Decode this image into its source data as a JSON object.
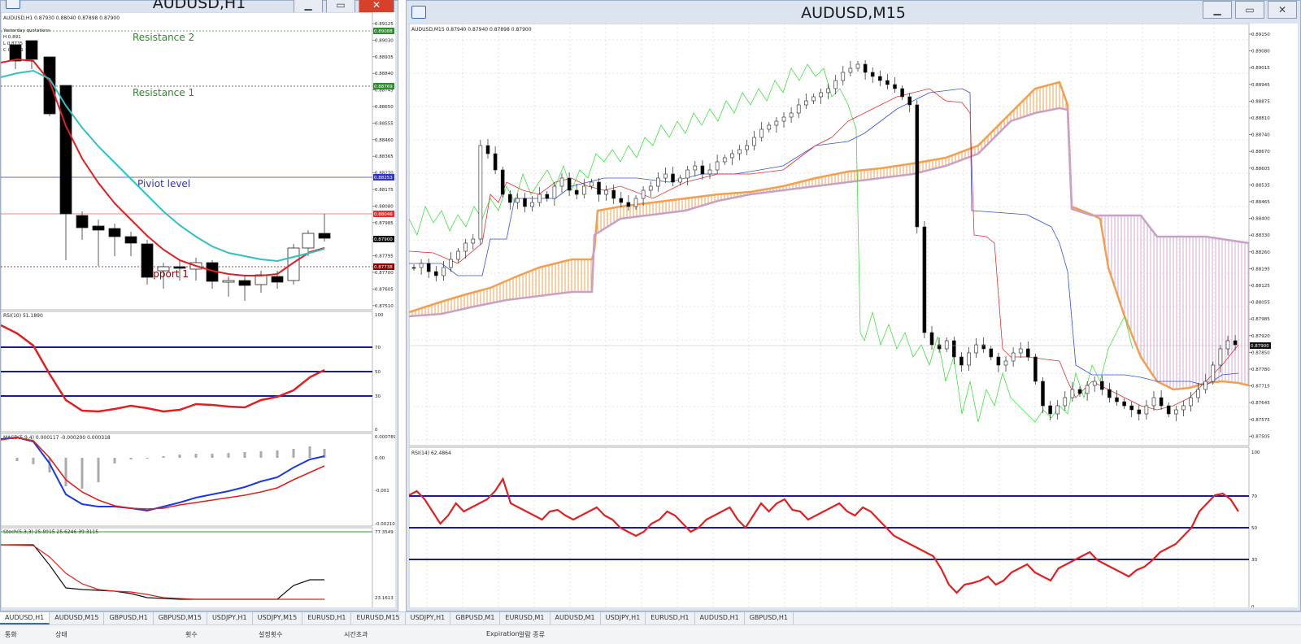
{
  "left_window": {
    "title": "AUDUSD,H1",
    "info_line": "AUDUSD,H1  0.87930 0.88040 0.87898 0.87900",
    "yesterday_label": "Yesterday quotations",
    "yesterday_h": "H 0.891",
    "yesterday_l": "L 0.8735",
    "yesterday_c": "C 0.8791",
    "annotations": {
      "resistance2": "Resistance 2",
      "resistance1": "Resistance 1",
      "pivot": "Piviot level",
      "support1": "Support 1"
    },
    "price_axis": [
      "0.89125",
      "0.89030",
      "0.88935",
      "0.88840",
      "0.88745",
      "0.88650",
      "0.88555",
      "0.88460",
      "0.88365",
      "0.88270",
      "0.88175",
      "0.88080",
      "0.87985",
      "0.87890",
      "0.87795",
      "0.87700",
      "0.87605",
      "0.87510"
    ],
    "price_tags": {
      "r2": "0.89088",
      "r1": "0.88769",
      "pivot": "0.88253",
      "red": "0.88046",
      "current": "0.87900",
      "s1": "0.87738"
    },
    "rsi_label": "RSI(10) 51.1890",
    "rsi_axis": [
      "100",
      "70",
      "50",
      "30",
      "0"
    ],
    "macd_label": "MACD(5,9,4) 0.000117 -0.000200 0.000318",
    "macd_axis": [
      "0.000789",
      "0.00",
      "-0.001",
      "-0.002107"
    ],
    "stoch_label": "Stoch(5,3,3) 25.8915 25.6246 39.3115",
    "stoch_axis": [
      "77.3549",
      "23.1613"
    ],
    "colors": {
      "annotation_green": "#2e8b2e",
      "pivot_blue": "#3030d0",
      "support_red": "#8b0000"
    }
  },
  "right_window": {
    "title": "AUDUSD,M15",
    "info_line": "AUDUSD,M15  0.87940 0.87940 0.87898 0.87900",
    "price_axis": [
      "0.89150",
      "0.89080",
      "0.89015",
      "0.88945",
      "0.88875",
      "0.88810",
      "0.88740",
      "0.88670",
      "0.88605",
      "0.88535",
      "0.88465",
      "0.88400",
      "0.88330",
      "0.88260",
      "0.88195",
      "0.88125",
      "0.88055",
      "0.87985",
      "0.87920",
      "0.87850",
      "0.87780",
      "0.87715",
      "0.87645",
      "0.87575",
      "0.87505"
    ],
    "current_price": "0.87900",
    "rsi_label": "RSI(14) 62.4864",
    "rsi_axis": [
      "100",
      "70",
      "50",
      "30",
      "0"
    ],
    "colors": {
      "kumo_bull": "#f0a050",
      "kumo_bear": "#c8a0c8",
      "tenkan": "#e03030",
      "kijun": "#3050e0",
      "chikou": "#40e040"
    }
  },
  "tabs": [
    "AUDUSD,H1",
    "AUDUSD,M15",
    "GBPUSD,H1",
    "GBPUSD,M15",
    "USDJPY,H1",
    "USDJPY,M15",
    "EURUSD,H1",
    "EURUSD,M15",
    "USDJPY,H1",
    "GBPUSD,M1",
    "EURUSD,M1",
    "AUDUSD,M1",
    "USDJPY,H1",
    "EURUSD,H1",
    "AUDUSD,H1",
    "GBPUSD,H1"
  ],
  "status": {
    "col1": "통화",
    "col2": "상태",
    "col3": "횟수",
    "col4": "설정횟수",
    "col5": "시간초과",
    "col6": "Expiration",
    "col7": "알람 종류"
  }
}
